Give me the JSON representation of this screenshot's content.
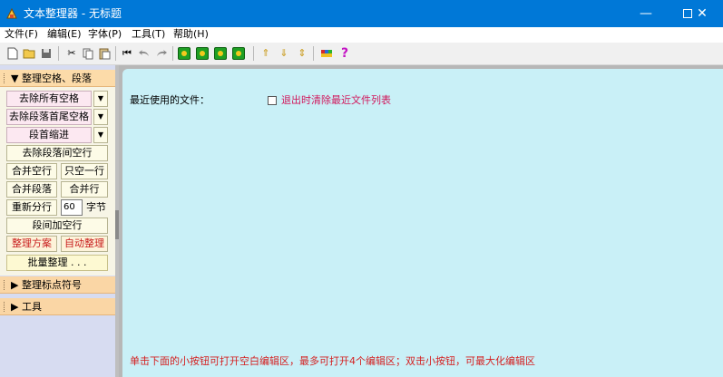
{
  "window": {
    "title": "文本整理器 - 无标题",
    "controls": {
      "minimize": "—",
      "close": "✕"
    }
  },
  "menu": [
    "文件(F)",
    "编辑(E)",
    "字体(P)",
    "工具(T)",
    "帮助(H)"
  ],
  "toolbar": {
    "icons": [
      "new-file-icon",
      "open-folder-icon",
      "save-icon",
      "cut-icon",
      "copy-icon",
      "paste-icon",
      "first-icon",
      "undo-icon",
      "redo-icon",
      "green-arrow-1-icon",
      "green-arrow-2-icon",
      "green-arrow-3-icon",
      "green-arrow-4-icon",
      "arrow-up-icon",
      "arrow-down-icon",
      "arrow-updown-icon",
      "color-icon",
      "help-icon"
    ],
    "glyphs": {
      "cut": "✂",
      "first": "⏮",
      "up": "⇑",
      "down": "⇓",
      "updown": "⇕",
      "help": "?"
    }
  },
  "sidebar": {
    "section1": "▼ 整理空格、段落",
    "buttons": {
      "remove_all_spaces": "去除所有空格",
      "trim_para_spaces": "去除段落首尾空格",
      "para_indent": "段首缩进",
      "remove_blank_lines": "去除段落间空行",
      "merge_blank_lines": "合并空行",
      "keep_one_blank": "只空一行",
      "merge_paragraphs": "合并段落",
      "merge_lines": "合并行",
      "rewrap": "重新分行",
      "add_blank_between": "段间加空行",
      "schemes": "整理方案",
      "auto_tidy": "自动整理",
      "batch": "批量整理 . . ."
    },
    "dropdown_glyph": "▼",
    "rewrap_value": "60",
    "rewrap_unit": "字节",
    "section2": "▶ 整理标点符号",
    "section3": "▶ 工具"
  },
  "main": {
    "recent_label": "最近使用的文件：",
    "clear_recent": "退出时清除最近文件列表",
    "hint": "单击下面的小按钮可打开空白编辑区，最多可打开4个编辑区；双击小按钮，可最大化编辑区"
  },
  "colors": {
    "titlebar": "#0078d7",
    "editor_bg": "#c9f0f7",
    "section_header": "#fad6a5",
    "hint_text": "#d42020",
    "checkbox_label": "#d1175b"
  }
}
